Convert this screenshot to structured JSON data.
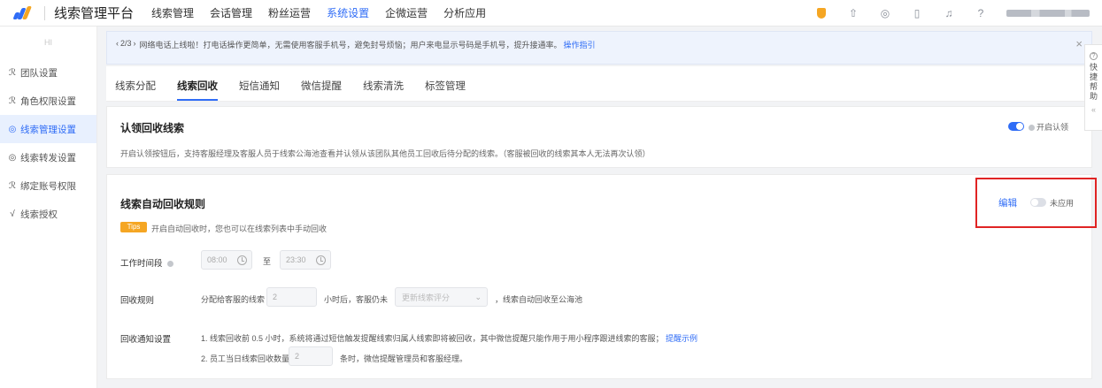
{
  "app": {
    "title": "线索管理平台"
  },
  "nav": {
    "items": [
      "线索管理",
      "会话管理",
      "粉丝运营",
      "系统设置",
      "企微运营",
      "分析应用"
    ],
    "active_index": 3
  },
  "top_icons": [
    "shield-icon",
    "upload-icon",
    "palette-icon",
    "mobile-icon",
    "bell-icon",
    "help-icon"
  ],
  "user": {
    "name_blurred": true,
    "caret": "▾"
  },
  "sidebar": {
    "top_label": "HI",
    "items": [
      {
        "label": "团队设置",
        "icon": "team-icon",
        "glyph": "ℛ"
      },
      {
        "label": "角色权限设置",
        "icon": "role-icon",
        "glyph": "ℛ"
      },
      {
        "label": "线索管理设置",
        "icon": "settings-icon",
        "glyph": "◎"
      },
      {
        "label": "线索转发设置",
        "icon": "forward-icon",
        "glyph": "◎"
      },
      {
        "label": "绑定账号权限",
        "icon": "bind-icon",
        "glyph": "ℛ"
      },
      {
        "label": "线索授权",
        "icon": "auth-icon",
        "glyph": "√"
      }
    ],
    "active_index": 2
  },
  "notice": {
    "pager": "2/3",
    "text": "网络电话上线啦！打电话操作更简单，无需使用客服手机号，避免封号烦恼；用户来电显示号码是手机号，提升接通率。",
    "link": "操作指引",
    "close": "×"
  },
  "tabs": {
    "items": [
      "线索分配",
      "线索回收",
      "短信通知",
      "微信提醒",
      "线索清洗",
      "标签管理"
    ],
    "active_index": 1
  },
  "claim_card": {
    "title": "认领回收线索",
    "toggle_on": true,
    "toggle_label": "开启认领",
    "description": "开启认领按钮后，支持客服经理及客服人员于线索公海池查看并认领从该团队其他员工回收后待分配的线索。（客服被回收的线索其本人无法再次认领）"
  },
  "auto_card": {
    "title": "线索自动回收规则",
    "edit_label": "编辑",
    "toggle_on": false,
    "toggle_label": "未应用",
    "tips_badge": "Tips",
    "tips_text": "开启自动回收时，您也可以在线索列表中手动回收",
    "work_time_label": "工作时间段",
    "start_time": "08:00",
    "to_label": "至",
    "end_time": "23:30",
    "rule_label": "回收规则",
    "rule_prefix": "分配给客服的线索",
    "hours_value": "2",
    "rule_middle": "小时后，客服仍未",
    "select_placeholder": "更新线索评分",
    "rule_suffix": "，线索自动回收至公海池",
    "notify_label": "回收通知设置",
    "notify_line1": "1. 线索回收前 0.5 小时，系统将通过短信触发提醒线索归属人线索即将被回收，其中微信提醒只能作用于用小程序跟进线索的客服；",
    "notify_line1_link": "提醒示例",
    "notify_line2_prefix": "2. 员工当日线索回收数量超过",
    "notify_count": "2",
    "notify_line2_suffix": "条时，微信提醒管理员和客服经理。"
  },
  "help_panel": {
    "chars": [
      "快",
      "捷",
      "帮",
      "助"
    ],
    "collapse": "«"
  },
  "colors": {
    "accent": "#2f6cf6",
    "brand_orange": "#f5a623",
    "highlight_red": "#e02424"
  }
}
